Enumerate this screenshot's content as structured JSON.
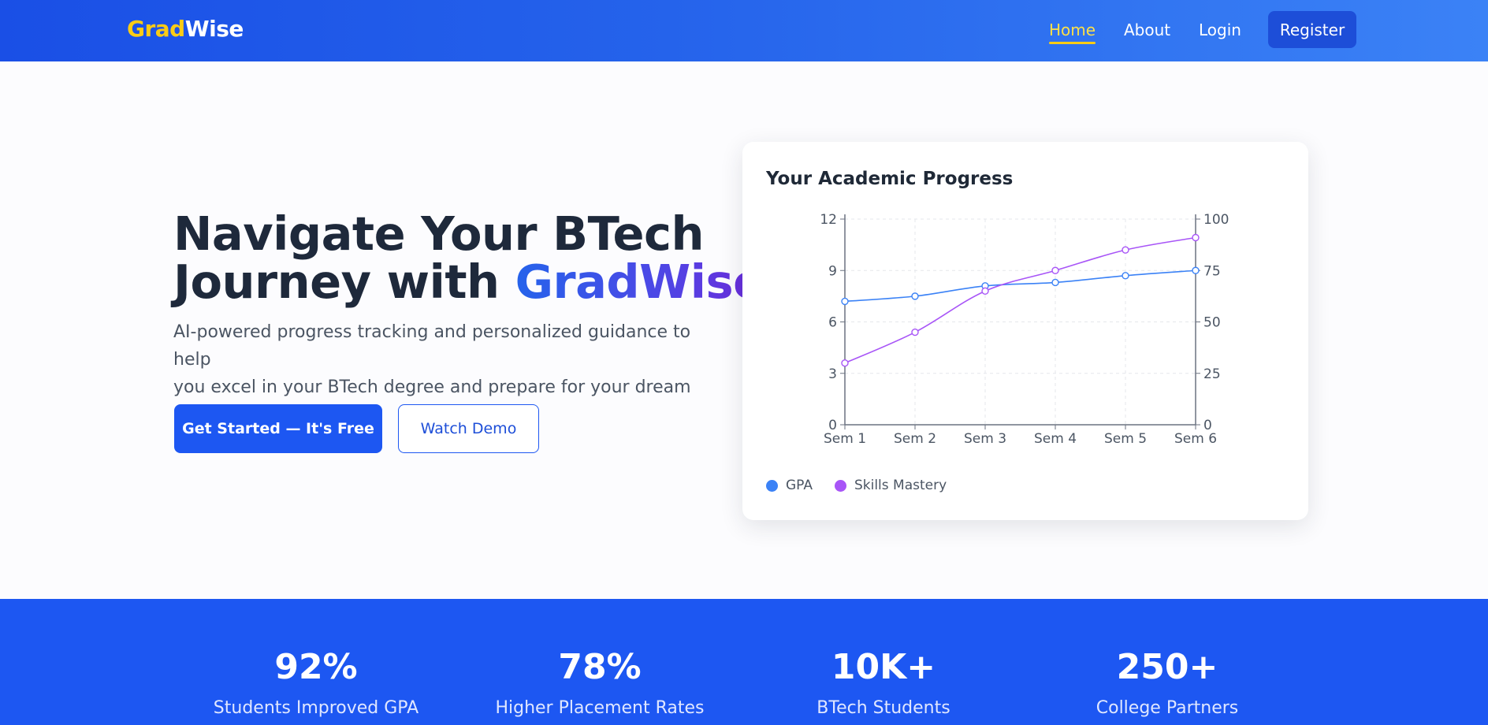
{
  "brand": {
    "logo_part1": "Grad",
    "logo_part2": "Wise",
    "colors": {
      "primary": "#1d57f2",
      "accent": "#facc15",
      "gpa": "#3b82f6",
      "skills": "#a855f7"
    }
  },
  "nav": {
    "home": "Home",
    "about": "About",
    "login": "Login",
    "register": "Register"
  },
  "hero": {
    "title_line1": "Navigate Your BTech",
    "title_line2_prefix": "Journey with ",
    "title_line2_accent": "GradWise",
    "subtitle_line1": "AI-powered progress tracking and personalized guidance to help",
    "subtitle_line2": "you excel in your BTech degree and prepare for your dream career.",
    "cta_primary": "Get Started — It's Free",
    "cta_secondary": "Watch Demo"
  },
  "chart_card": {
    "title": "Your Academic Progress"
  },
  "chart_data": {
    "type": "line",
    "categories": [
      "Sem 1",
      "Sem 2",
      "Sem 3",
      "Sem 4",
      "Sem 5",
      "Sem 6"
    ],
    "y_left": {
      "ticks": [
        "0",
        "3",
        "6",
        "9",
        "12"
      ],
      "min": 0,
      "max": 12
    },
    "y_right": {
      "ticks": [
        "0",
        "25",
        "50",
        "75",
        "100"
      ],
      "min": 0,
      "max": 100
    },
    "grid": true,
    "legend_position": "bottom-left",
    "series": [
      {
        "name": "GPA",
        "axis": "left",
        "color": "#3b82f6",
        "values": [
          7.2,
          7.5,
          8.1,
          8.3,
          8.7,
          9.0
        ]
      },
      {
        "name": "Skills Mastery",
        "axis": "right",
        "color": "#a855f7",
        "values": [
          30,
          45,
          65,
          75,
          85,
          91
        ]
      }
    ]
  },
  "stats": [
    {
      "value": "92%",
      "label": "Students Improved GPA"
    },
    {
      "value": "78%",
      "label": "Higher Placement Rates"
    },
    {
      "value": "10K+",
      "label": "BTech Students"
    },
    {
      "value": "250+",
      "label": "College Partners"
    }
  ]
}
